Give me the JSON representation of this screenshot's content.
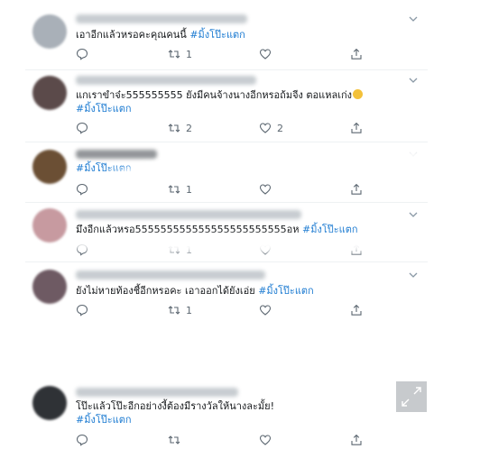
{
  "tweets": [
    {
      "text": "เอาอีกแล้วหรอคะคุณคนนี้",
      "hashtag": "#มิ้งโป๊ะแตก",
      "reply_count": "",
      "retweet_count": "1",
      "like_count": "",
      "avatar_color": "#a9b0b8"
    },
    {
      "text": "แกเราขำจ๋ะ555555555 ยังมีคนจ้างนางอีกหรอถ้มจีง ตอแหลเก่ง",
      "hashtag": "#มิ้งโป๊ะแตก",
      "reply_count": "",
      "retweet_count": "2",
      "like_count": "2",
      "avatar_color": "#5b4a4a"
    },
    {
      "text": "",
      "hashtag": "#มิ้งโป๊ะแตก",
      "reply_count": "",
      "retweet_count": "1",
      "like_count": "",
      "avatar_color": "#6b4f34"
    },
    {
      "text": "มึงอีกแล้วหรอ555555555555555555555555อห",
      "hashtag": "#มิ้งโป๊ะแตก",
      "reply_count": "",
      "retweet_count": "1",
      "like_count": "",
      "avatar_color": "#c79aa0"
    },
    {
      "text": "ยังไม่หายท้องชี้อีกหรอคะ เอาออกได้ยังเอ่ย",
      "hashtag": "#มิ้งโป๊ะแตก",
      "reply_count": "",
      "retweet_count": "1",
      "like_count": "",
      "avatar_color": "#6e5a63"
    },
    {
      "text": "โป๊ะแล้วโป๊ะอีกอย่างงี้ต้องมีรางวัลให้นางละมั้ย!",
      "hashtag": "#มิ้งโป๊ะแตก",
      "reply_count": "",
      "retweet_count": "",
      "like_count": "",
      "avatar_color": "#2f3236"
    }
  ],
  "colors": {
    "hashtag": "#1b7ad1",
    "action_icon": "#5b6670",
    "text": "#14171a"
  },
  "icons": {
    "reply": "speech-bubble-icon",
    "retweet": "retweet-arrows-icon",
    "like": "heart-icon",
    "share": "share-upload-icon",
    "menu": "chevron-down-icon",
    "expand": "expand-arrows-icon"
  }
}
